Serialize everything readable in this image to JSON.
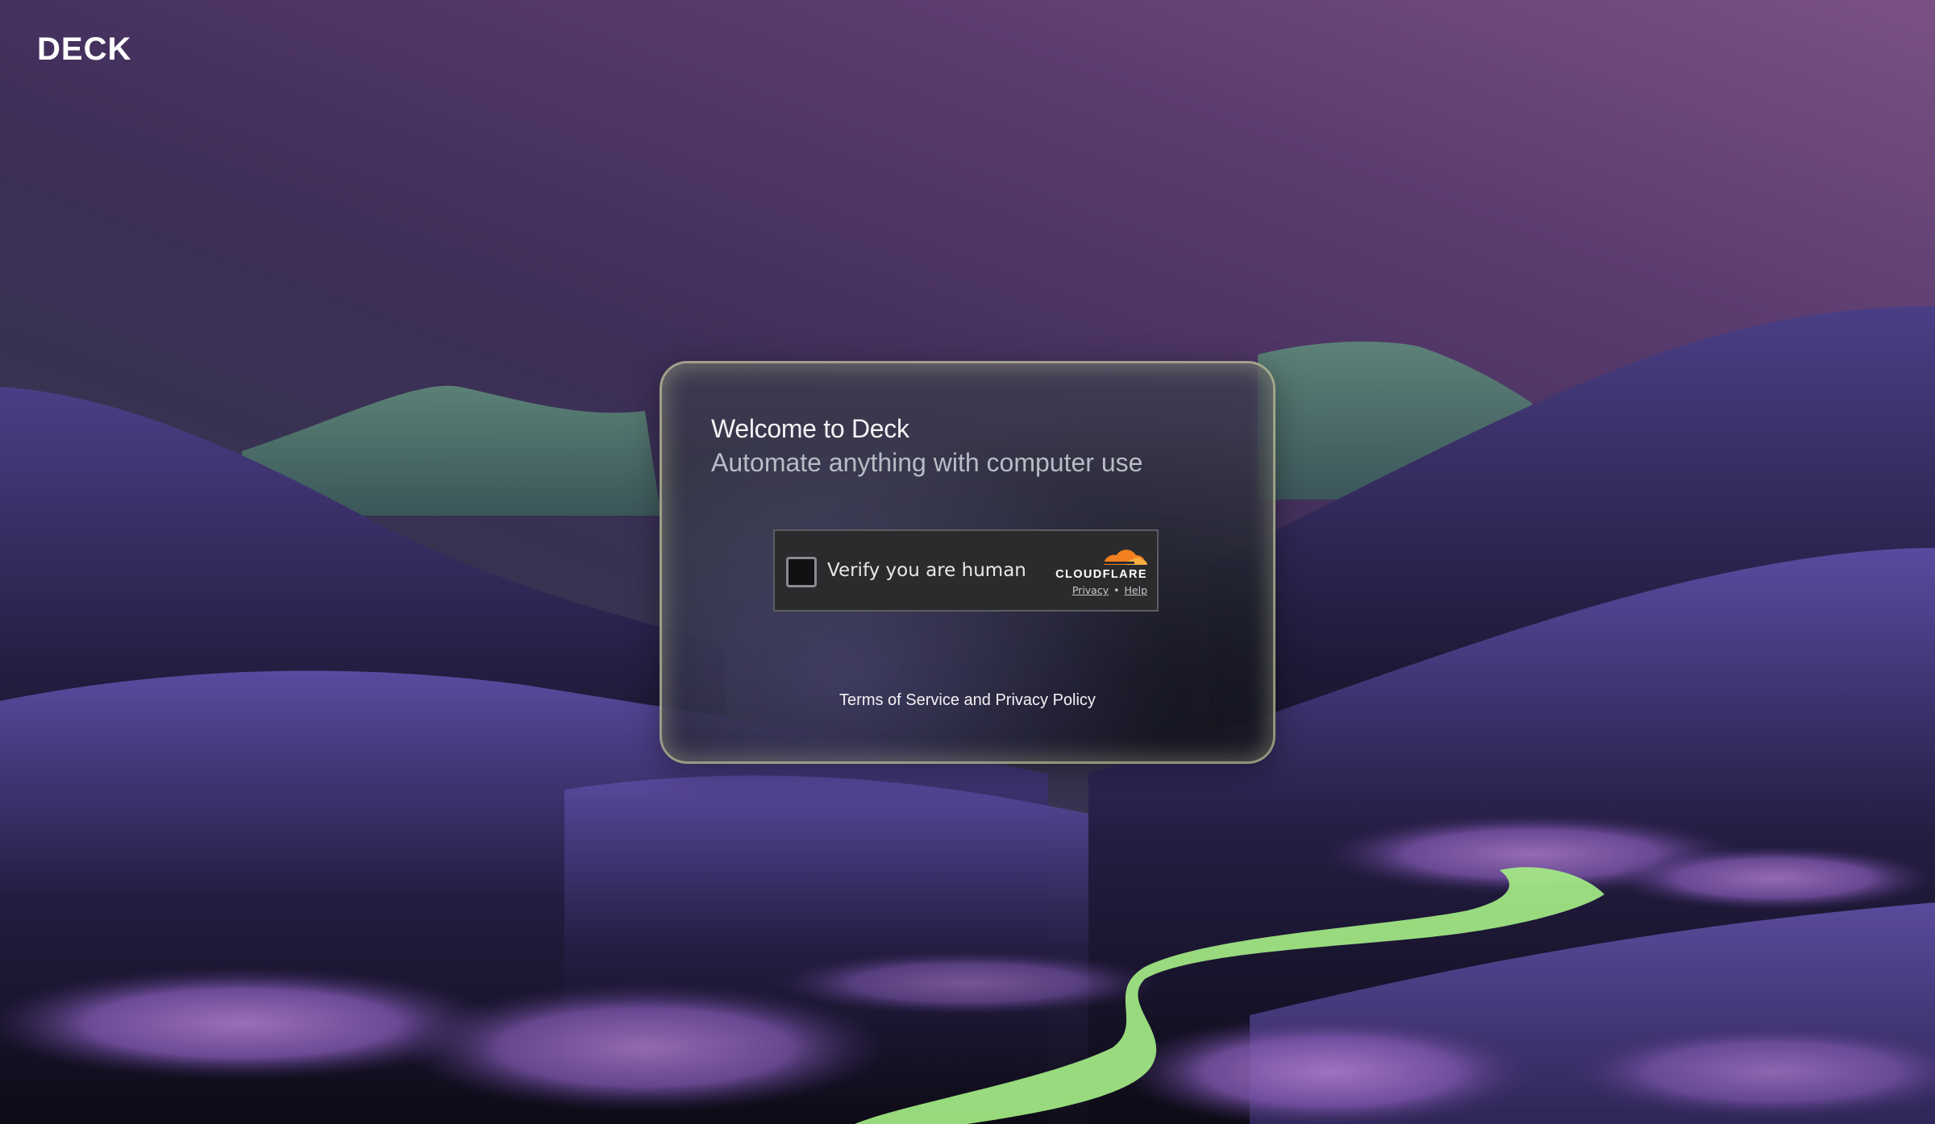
{
  "brand": {
    "logo_text": "DECK"
  },
  "welcome": {
    "title": "Welcome to Deck",
    "subtitle": "Automate anything with computer use"
  },
  "captcha": {
    "label": "Verify you are human",
    "checked": false,
    "provider": "CLOUDFLARE",
    "privacy_link": "Privacy",
    "separator": "•",
    "help_link": "Help"
  },
  "footer": {
    "terms_link": "Terms of Service and Privacy Policy"
  },
  "colors": {
    "cloudflare_orange": "#f38020",
    "cloudflare_light": "#faad3f",
    "path_green": "#a8f08a",
    "flower_purple": "#8a5fb8"
  }
}
